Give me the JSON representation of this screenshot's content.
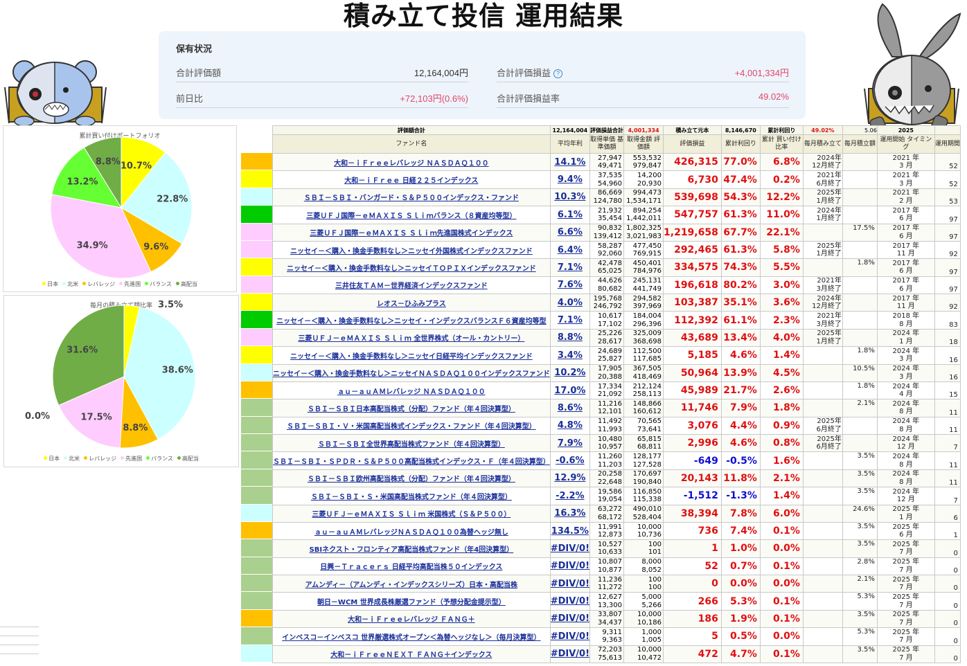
{
  "title": "積み立て投信 運用結果",
  "holdings": {
    "title": "保有状況",
    "total_value_label": "合計評価額",
    "total_value": "12,164,004円",
    "total_pl_label": "合計評価損益",
    "total_pl": "+4,001,334円",
    "day_change_label": "前日比",
    "day_change": "+72,103円(0.6%)",
    "total_pl_rate_label": "合計評価損益率",
    "total_pl_rate": "49.02%"
  },
  "colors": {
    "japan": "#ffff00",
    "north_america": "#ccffff",
    "leverage": "#ffc000",
    "developed": "#ffccff",
    "balance": "#66ff33",
    "high_dividend": "#70ad47",
    "high_dividend_light": "#a9d08e",
    "green_dark": "#00cc00"
  },
  "chart_data": [
    {
      "type": "pie",
      "title": "累計買い付けポートフォリオ",
      "categories": [
        "日本",
        "北米",
        "レバレッジ",
        "先進国",
        "バランス",
        "高配当"
      ],
      "values": [
        10.7,
        22.8,
        9.6,
        34.9,
        13.2,
        8.8
      ],
      "labels": [
        "10.7%",
        "22.8%",
        "9.6%",
        "34.9%",
        "13.2%",
        "8.8%"
      ],
      "colors": [
        "#ffff00",
        "#ccffff",
        "#ffc000",
        "#ffccff",
        "#66ff33",
        "#70ad47"
      ],
      "legend": "bottom"
    },
    {
      "type": "pie",
      "title": "毎月の積み立て額比率",
      "categories": [
        "日本",
        "北米",
        "レバレッジ",
        "先進国",
        "バランス",
        "高配当"
      ],
      "values": [
        3.5,
        38.6,
        8.8,
        17.5,
        0.0,
        31.6
      ],
      "labels": [
        "3.5%",
        "38.6%",
        "8.8%",
        "17.5%",
        "0.0%",
        "31.6%"
      ],
      "colors": [
        "#ffff00",
        "#ccffff",
        "#ffc000",
        "#ffccff",
        "#66ff33",
        "#70ad47"
      ],
      "legend": "bottom"
    }
  ],
  "summary": {
    "eval_total_label": "評価額合計",
    "eval_total": "12,164,004",
    "pl_total_label": "評価損益合計",
    "pl_total": "4,001,334",
    "principal_label": "積み立て元本",
    "principal": "8,146,670",
    "yield_label": "累計利回り",
    "yield": "49.02%",
    "monthly_total": "5.06",
    "year": "2025"
  },
  "headers": [
    "ファンド名",
    "平均年利",
    "取得単価 基準価額",
    "取得金額 評価額",
    "評価損益",
    "累計利回り",
    "累計 買い付け比率",
    "毎月積み立て",
    "毎月積立額",
    "運用開始 タイミング",
    "運用期間"
  ],
  "funds": [
    {
      "color": "#ffc000",
      "name": "大和－ｉＦｒｅｅレバレッジ ＮＡＳＤＡＱ１００",
      "avg": "14.1%",
      "unit": "27,947",
      "nav": "49,471",
      "cost": "553,532",
      "value": "979,847",
      "pl": "426,315",
      "yield": "77.0%",
      "ratio": "6.8%",
      "ended": "2024年\n12月終了",
      "rate": "",
      "start": "2021 年\n3 月",
      "period": "52"
    },
    {
      "color": "#ffff00",
      "name": "大和－ｉＦｒｅｅ 日経２２５インデックス",
      "avg": "9.4%",
      "unit": "37,535",
      "nav": "54,960",
      "cost": "14,200",
      "value": "20,930",
      "pl": "6,730",
      "yield": "47.4%",
      "ratio": "0.2%",
      "ended": "2021年\n6月終了",
      "rate": "",
      "start": "2021 年\n3 月",
      "period": "52"
    },
    {
      "color": "#ccffff",
      "name": "ＳＢＩ－ＳＢＩ・バンガード・Ｓ＆Ｐ５００インデックス・ファンド",
      "avg": "10.3%",
      "unit": "86,669",
      "nav": "124,780",
      "cost": "994,473",
      "value": "1,534,171",
      "pl": "539,698",
      "yield": "54.3%",
      "ratio": "12.2%",
      "ended": "2025年\n1月終了",
      "rate": "",
      "start": "2021 年\n2 月",
      "period": "53"
    },
    {
      "color": "#00cc00",
      "name": "三菱ＵＦＪ国際－ｅＭＡＸＩＳ Ｓｌｉｍバランス（８資産均等型）",
      "avg": "6.1%",
      "unit": "21,932",
      "nav": "35,454",
      "cost": "894,254",
      "value": "1,442,011",
      "pl": "547,757",
      "yield": "61.3%",
      "ratio": "11.0%",
      "ended": "2024年\n1月終了",
      "rate": "",
      "start": "2017 年\n6 月",
      "period": "97"
    },
    {
      "color": "#ffccff",
      "name": "三菱ＵＦＪ国際－ｅＭＡＸＩＳ Ｓｌｉｍ先進国株式インデックス",
      "avg": "6.6%",
      "unit": "90,832",
      "nav": "139,412",
      "cost": "1,802,325",
      "value": "3,021,983",
      "pl": "1,219,658",
      "yield": "67.7%",
      "ratio": "22.1%",
      "ended": "",
      "rate": "17.5%",
      "start": "2017 年\n6 月",
      "period": "97"
    },
    {
      "color": "#ffccff",
      "name": "ニッセイ－＜購入・換金手数料なし＞ニッセイ外国株式インデックスファンド",
      "avg": "6.4%",
      "unit": "58,287",
      "nav": "92,060",
      "cost": "477,450",
      "value": "769,915",
      "pl": "292,465",
      "yield": "61.3%",
      "ratio": "5.8%",
      "ended": "2025年\n1月終了",
      "rate": "",
      "start": "2017 年\n11 月",
      "period": "92"
    },
    {
      "color": "#ffff00",
      "name": "ニッセイ－＜購入・換金手数料なし＞ニッセイＴＯＰＩＸインデックスファンド",
      "avg": "7.1%",
      "unit": "42,478",
      "nav": "65,025",
      "cost": "450,401",
      "value": "784,976",
      "pl": "334,575",
      "yield": "74.3%",
      "ratio": "5.5%",
      "ended": "",
      "rate": "1.8%",
      "start": "2017 年\n6 月",
      "period": "97"
    },
    {
      "color": "#ffccff",
      "name": "三井住友ＴＡＭ－世界経済インデックスファンド",
      "avg": "7.6%",
      "unit": "44,626",
      "nav": "80,682",
      "cost": "245,131",
      "value": "441,749",
      "pl": "196,618",
      "yield": "80.2%",
      "ratio": "3.0%",
      "ended": "2021年\n3月終了",
      "rate": "",
      "start": "2017 年\n6 月",
      "period": "97"
    },
    {
      "color": "#ffff00",
      "name": "レオス－ひふみプラス",
      "avg": "4.0%",
      "unit": "195,768",
      "nav": "246,792",
      "cost": "294,582",
      "value": "397,969",
      "pl": "103,387",
      "yield": "35.1%",
      "ratio": "3.6%",
      "ended": "2024年\n12月終了",
      "rate": "",
      "start": "2017 年\n11 月",
      "period": "92"
    },
    {
      "color": "#00cc00",
      "name": "ニッセイ－＜購入・換金手数料なし＞ニッセイ・インデックスバランスＦ６資産均等型",
      "avg": "7.1%",
      "unit": "10,617",
      "nav": "17,102",
      "cost": "184,004",
      "value": "296,396",
      "pl": "112,392",
      "yield": "61.1%",
      "ratio": "2.3%",
      "ended": "2021年\n3月終了",
      "rate": "",
      "start": "2018 年\n8 月",
      "period": "83"
    },
    {
      "color": "#ffccff",
      "name": "三菱ＵＦＪ－ｅＭＡＸＩＳ Ｓｌｉｍ 全世界株式（オール・カントリー）",
      "avg": "8.8%",
      "unit": "25,226",
      "nav": "28,617",
      "cost": "325,009",
      "value": "368,698",
      "pl": "43,689",
      "yield": "13.4%",
      "ratio": "4.0%",
      "ended": "2025年\n1月終了",
      "rate": "",
      "start": "2024 年\n1 月",
      "period": "18"
    },
    {
      "color": "#ffff00",
      "name": "ニッセイ－＜購入・換金手数料なし＞ニッセイ日経平均インデックスファンド",
      "avg": "3.4%",
      "unit": "24,689",
      "nav": "25,827",
      "cost": "112,500",
      "value": "117,685",
      "pl": "5,185",
      "yield": "4.6%",
      "ratio": "1.4%",
      "ended": "",
      "rate": "1.8%",
      "start": "2024 年\n3 月",
      "period": "16"
    },
    {
      "color": "#ccffff",
      "name": "ニッセイ－＜購入・換金手数料なし＞ニッセイＮＡＳＤＡＱ１００インデックスファンド",
      "avg": "10.2%",
      "unit": "17,905",
      "nav": "20,388",
      "cost": "367,505",
      "value": "418,469",
      "pl": "50,964",
      "yield": "13.9%",
      "ratio": "4.5%",
      "ended": "",
      "rate": "10.5%",
      "start": "2024 年\n3 月",
      "period": "16"
    },
    {
      "color": "#ffc000",
      "name": "ａｕ－ａｕＡＭレバレッジ ＮＡＳＤＡＱ１００",
      "avg": "17.0%",
      "unit": "17,334",
      "nav": "21,092",
      "cost": "212,124",
      "value": "258,113",
      "pl": "45,989",
      "yield": "21.7%",
      "ratio": "2.6%",
      "ended": "",
      "rate": "1.8%",
      "start": "2024 年\n4 月",
      "period": "15"
    },
    {
      "color": "#a9d08e",
      "name": "ＳＢＩ－ＳＢＩ日本高配当株式（分配）ファンド（年４回決算型）",
      "avg": "8.6%",
      "unit": "11,216",
      "nav": "12,101",
      "cost": "148,866",
      "value": "160,612",
      "pl": "11,746",
      "yield": "7.9%",
      "ratio": "1.8%",
      "ended": "",
      "rate": "2.1%",
      "start": "2024 年\n8 月",
      "period": "11"
    },
    {
      "color": "#a9d08e",
      "name": "ＳＢＩ－ＳＢＩ・Ｖ・米国高配当株式インデックス・ファンド（年４回決算型）",
      "avg": "4.8%",
      "unit": "11,492",
      "nav": "11,993",
      "cost": "70,565",
      "value": "73,641",
      "pl": "3,076",
      "yield": "4.4%",
      "ratio": "0.9%",
      "ended": "2025年\n6月終了",
      "rate": "",
      "start": "2024 年\n8 月",
      "period": "11"
    },
    {
      "color": "#a9d08e",
      "name": "ＳＢＩ－ＳＢＩ全世界高配当株式ファンド（年４回決算型）",
      "avg": "7.9%",
      "unit": "10,480",
      "nav": "10,957",
      "cost": "65,815",
      "value": "68,811",
      "pl": "2,996",
      "yield": "4.6%",
      "ratio": "0.8%",
      "ended": "2025年\n6月終了",
      "rate": "",
      "start": "2024 年\n12 月",
      "period": "7"
    },
    {
      "color": "#a9d08e",
      "name": "ＳＢＩ－ＳＢＩ・ＳＰＤＲ・Ｓ＆Ｐ５００高配当株式インデックス・Ｆ（年４回決算型）",
      "avg": "-0.6%",
      "unit": "11,260",
      "nav": "11,203",
      "cost": "128,177",
      "value": "127,528",
      "pl": "-649",
      "yield": "-0.5%",
      "ratio": "1.6%",
      "ended": "",
      "rate": "3.5%",
      "start": "2024 年\n8 月",
      "period": "11"
    },
    {
      "color": "#a9d08e",
      "name": "ＳＢＩ－ＳＢＩ欧州高配当株式（分配）ファンド（年４回決算型）",
      "avg": "12.9%",
      "unit": "20,258",
      "nav": "22,648",
      "cost": "170,697",
      "value": "190,840",
      "pl": "20,143",
      "yield": "11.8%",
      "ratio": "2.1%",
      "ended": "",
      "rate": "3.5%",
      "start": "2024 年\n8 月",
      "period": "11"
    },
    {
      "color": "#a9d08e",
      "name": "ＳＢＩ－ＳＢＩ・Ｓ・米国高配当株式ファンド（年４回決算型）",
      "avg": "-2.2%",
      "unit": "19,586",
      "nav": "19,054",
      "cost": "116,850",
      "value": "115,338",
      "pl": "-1,512",
      "yield": "-1.3%",
      "ratio": "1.4%",
      "ended": "",
      "rate": "3.5%",
      "start": "2024 年\n12 月",
      "period": "7"
    },
    {
      "color": "#ccffff",
      "name": "三菱ＵＦＪ－ｅＭＡＸＩＳ Ｓｌｉｍ 米国株式（Ｓ＆Ｐ５００）",
      "avg": "16.3%",
      "unit": "63,272",
      "nav": "68,172",
      "cost": "490,010",
      "value": "528,404",
      "pl": "38,394",
      "yield": "7.8%",
      "ratio": "6.0%",
      "ended": "",
      "rate": "24.6%",
      "start": "2025 年\n1 月",
      "period": "6"
    },
    {
      "color": "#ffc000",
      "name": "ａｕ－ａｕＡＭレバレッジＮＡＳＤＡＱ１００為替ヘッジ無し",
      "avg": "134.5%",
      "unit": "11,991",
      "nav": "12,873",
      "cost": "10,000",
      "value": "10,736",
      "pl": "736",
      "yield": "7.4%",
      "ratio": "0.1%",
      "ended": "",
      "rate": "3.5%",
      "start": "2025 年\n6 月",
      "period": "1"
    },
    {
      "color": "#a9d08e",
      "name": "SBIネクスト・フロンティア高配当株式ファンド（年4回決算型）",
      "avg": "#DIV/0!",
      "unit": "10,527",
      "nav": "10,633",
      "cost": "100",
      "value": "101",
      "pl": "1",
      "yield": "1.0%",
      "ratio": "0.0%",
      "ended": "",
      "rate": "3.5%",
      "start": "2025 年\n7 月",
      "period": "0"
    },
    {
      "color": "#a9d08e",
      "name": "日興－Ｔｒａｃｅｒｓ 日経平均高配当株５０インデックス",
      "avg": "#DIV/0!",
      "unit": "10,807",
      "nav": "10,877",
      "cost": "8,000",
      "value": "8,052",
      "pl": "52",
      "yield": "0.7%",
      "ratio": "0.1%",
      "ended": "",
      "rate": "2.8%",
      "start": "2025 年\n7 月",
      "period": "0"
    },
    {
      "color": "#a9d08e",
      "name": "アムンディ－（アムンディ・インデックスシリーズ）日本・高配当株",
      "avg": "#DIV/0!",
      "unit": "11,236",
      "nav": "11,272",
      "cost": "100",
      "value": "100",
      "pl": "0",
      "yield": "0.0%",
      "ratio": "0.0%",
      "ended": "",
      "rate": "2.1%",
      "start": "2025 年\n7 月",
      "period": "0"
    },
    {
      "color": "#a9d08e",
      "name": "朝日－WCM 世界成長株厳選ファンド（予想分配金提示型）",
      "avg": "#DIV/0!",
      "unit": "12,627",
      "nav": "13,300",
      "cost": "5,000",
      "value": "5,266",
      "pl": "266",
      "yield": "5.3%",
      "ratio": "0.1%",
      "ended": "",
      "rate": "5.3%",
      "start": "2025 年\n7 月",
      "period": "0"
    },
    {
      "color": "#ffc000",
      "name": "大和－ｉＦｒｅｅレバレッジ ＦＡＮＧ＋",
      "avg": "#DIV/0!",
      "unit": "33,807",
      "nav": "34,437",
      "cost": "10,000",
      "value": "10,186",
      "pl": "186",
      "yield": "1.9%",
      "ratio": "0.1%",
      "ended": "",
      "rate": "3.5%",
      "start": "2025 年\n7 月",
      "period": "0"
    },
    {
      "color": "#a9d08e",
      "name": "インベスコ－インベスコ 世界厳選株式オープン＜為替ヘッジなし＞（毎月決算型）",
      "avg": "#DIV/0!",
      "unit": "9,311",
      "nav": "9,363",
      "cost": "1,000",
      "value": "1,005",
      "pl": "5",
      "yield": "0.5%",
      "ratio": "0.0%",
      "ended": "",
      "rate": "5.3%",
      "start": "2025 年\n7 月",
      "period": "0"
    },
    {
      "color": "#ccffff",
      "name": "大和－ｉＦｒｅｅＮＥＸＴ ＦＡＮＧ＋インデックス",
      "avg": "#DIV/0!",
      "unit": "72,203",
      "nav": "75,613",
      "cost": "10,000",
      "value": "10,472",
      "pl": "472",
      "yield": "4.7%",
      "ratio": "0.1%",
      "ended": "",
      "rate": "3.5%",
      "start": "2025 年\n7 月",
      "period": "0"
    }
  ]
}
